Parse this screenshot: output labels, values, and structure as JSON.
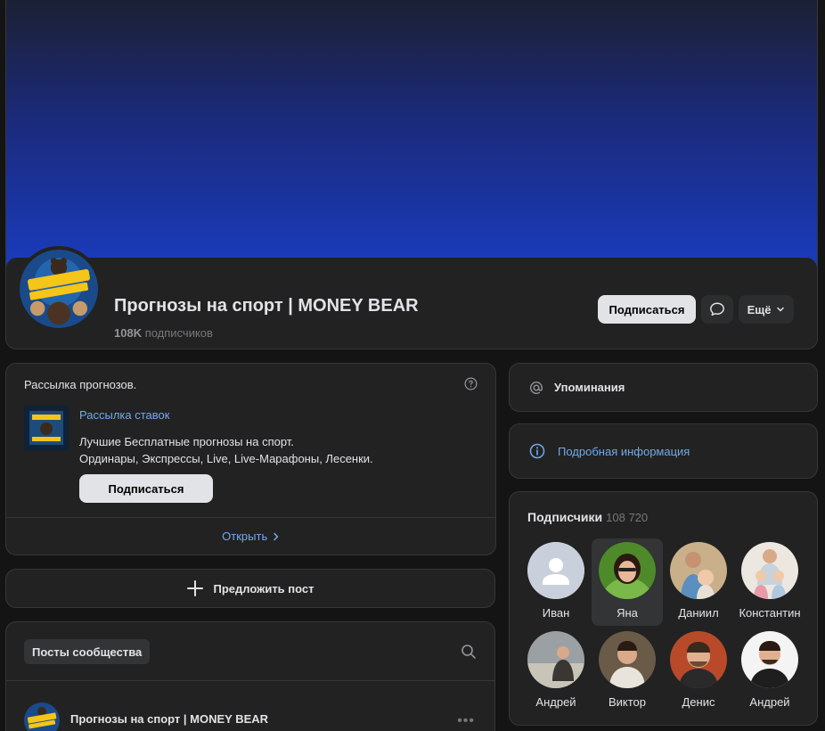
{
  "header": {
    "group_title": "Прогнозы на спорт | MONEY BEAR",
    "subscribers_count": "108K",
    "subscribers_suffix": "подписчиков",
    "subscribe_label": "Подписаться",
    "more_label": "Ещё",
    "avatar_logo_text": "MONEY BEAR",
    "avatar_logo_subtext": "ПРОГНОЗЫ НА СПОРТ"
  },
  "newsletter": {
    "title": "Рассылка прогнозов.",
    "link_label": "Рассылка ставок",
    "description_line1": "Лучшие Бесплатные прогнозы на спорт.",
    "description_line2": "Ординары, Экспрессы, Live, Live-Марафоны, Лесенки.",
    "subscribe_label": "Подписаться",
    "open_label": "Открыть"
  },
  "suggest": {
    "label": "Предложить пост"
  },
  "posts": {
    "tab_label": "Посты сообщества",
    "post_author": "Прогнозы на спорт | MONEY BEAR"
  },
  "sidebar": {
    "mentions_label": "Упоминания",
    "info_label": "Подробная информация",
    "members_title": "Подписчики",
    "members_count": "108 720",
    "members": [
      {
        "name": "Иван"
      },
      {
        "name": "Яна"
      },
      {
        "name": "Даниил"
      },
      {
        "name": "Константин"
      },
      {
        "name": "Андрей"
      },
      {
        "name": "Виктор"
      },
      {
        "name": "Денис"
      },
      {
        "name": "Андрей"
      }
    ]
  },
  "colors": {
    "background": "#141414",
    "card": "#222222",
    "accent_link": "#71aaeb",
    "button_light": "#e1e3e6",
    "cover_blue": "#1a3bbd"
  }
}
